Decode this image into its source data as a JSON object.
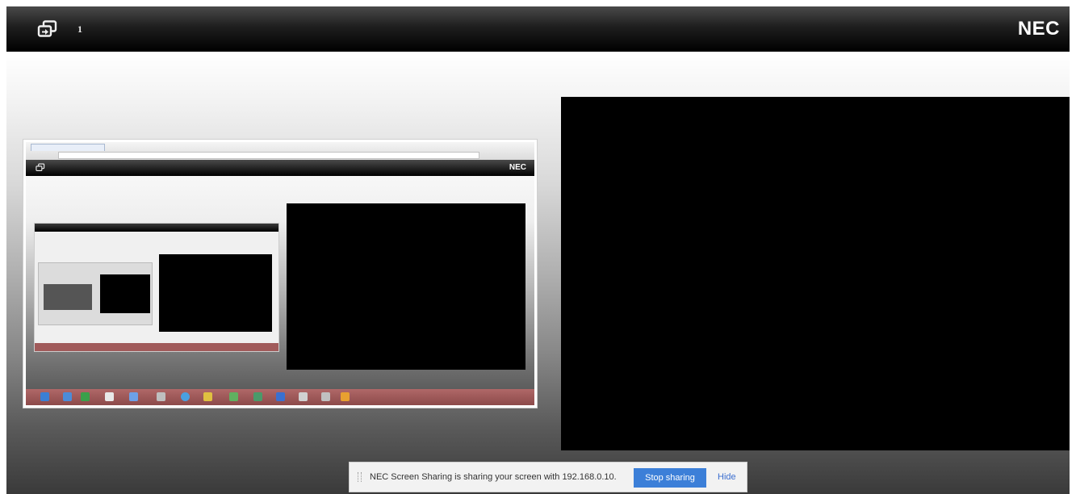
{
  "header": {
    "logo_icon": "screen-share-icon",
    "participant_count": "1",
    "brand": "NEC"
  },
  "local_preview": {
    "mini_brand": "NEC"
  },
  "share_bar": {
    "message": "NEC Screen Sharing is sharing your screen with 192.168.0.10.",
    "stop_label": "Stop sharing",
    "hide_label": "Hide",
    "button_color": "#3c7fd8"
  },
  "colors": {
    "header_bg": "#000000",
    "remote_video_bg": "#000000",
    "taskbar": "#a05a5a"
  }
}
